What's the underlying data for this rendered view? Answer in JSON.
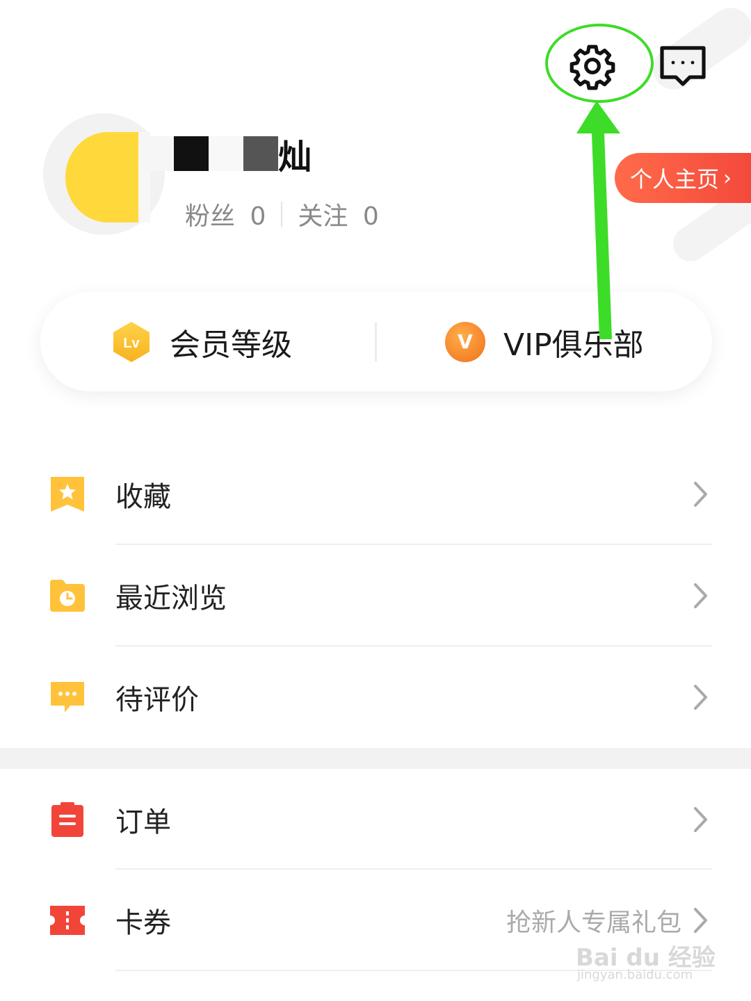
{
  "header": {
    "settings_icon": "gear-icon",
    "message_icon": "chat-bubble-icon"
  },
  "profile": {
    "username_visible": "灿",
    "fans_label": "粉丝",
    "fans_count": "0",
    "following_label": "关注",
    "following_count": "0",
    "homepage_button": "个人主页"
  },
  "member_card": {
    "level_badge": "Lv",
    "level_label": "会员等级",
    "vip_badge": "V",
    "vip_label": "VIP俱乐部"
  },
  "menu_section_1": [
    {
      "label": "收藏",
      "icon": "bookmark-star-icon"
    },
    {
      "label": "最近浏览",
      "icon": "folder-clock-icon"
    },
    {
      "label": "待评价",
      "icon": "comment-dots-icon"
    }
  ],
  "menu_section_2": [
    {
      "label": "订单",
      "icon": "clipboard-icon",
      "hint": ""
    },
    {
      "label": "卡券",
      "icon": "ticket-icon",
      "hint": "抢新人专属礼包"
    }
  ],
  "watermark": {
    "text": "Bai du 经验",
    "url": "jingyan.baidu.com"
  },
  "colors": {
    "accent_orange": "#f2453a",
    "vip_orange": "#f0701a",
    "level_yellow": "#ffc83d",
    "annotation_green": "#3ddc28"
  }
}
